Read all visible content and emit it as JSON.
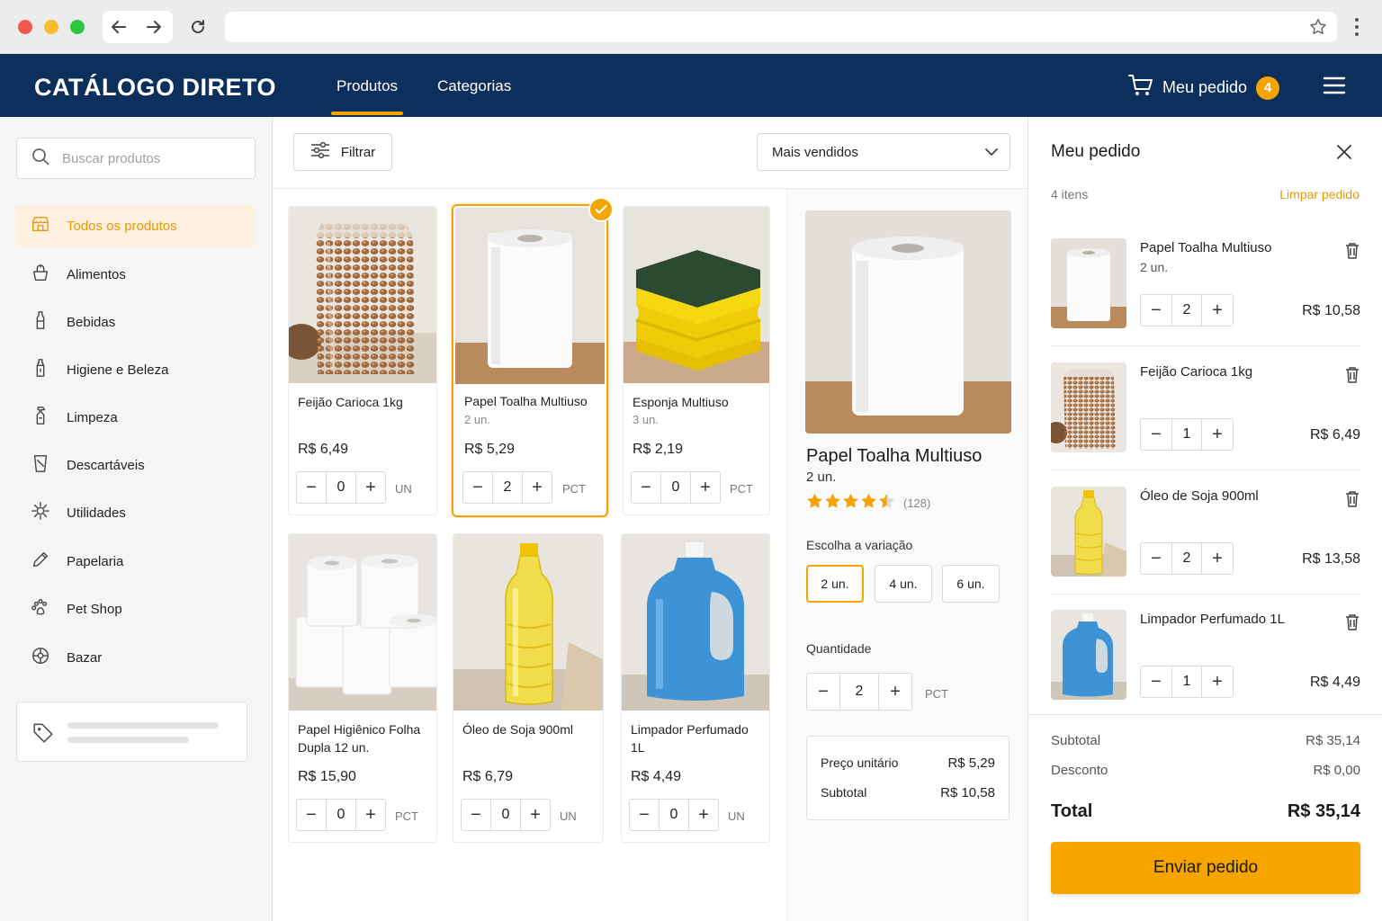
{
  "colors": {
    "brand_navy": "#0d2f5c",
    "accent": "#f5a400",
    "accent_text": "#e59a0c"
  },
  "header": {
    "brand": "CATÁLOGO DIRETO",
    "nav": [
      {
        "label": "Produtos",
        "active": true
      },
      {
        "label": "Categorias",
        "active": false
      }
    ],
    "cart_label": "Meu pedido",
    "cart_count": "4"
  },
  "sidebar": {
    "search_placeholder": "Buscar produtos",
    "categories": [
      {
        "label": "Todos os produtos",
        "icon": "store-icon",
        "active": true
      },
      {
        "label": "Alimentos",
        "icon": "food-icon"
      },
      {
        "label": "Bebidas",
        "icon": "bottle-icon"
      },
      {
        "label": "Higiene e Beleza",
        "icon": "hygiene-icon"
      },
      {
        "label": "Limpeza",
        "icon": "spray-bottle-icon"
      },
      {
        "label": "Descartáveis",
        "icon": "disposable-cup-icon"
      },
      {
        "label": "Utilidades",
        "icon": "utilities-icon"
      },
      {
        "label": "Papelaria",
        "icon": "pencil-icon"
      },
      {
        "label": "Pet Shop",
        "icon": "paw-icon"
      },
      {
        "label": "Bazar",
        "icon": "bazaar-icon"
      }
    ]
  },
  "toolbar": {
    "filter_label": "Filtrar",
    "sort_value": "Mais vendidos"
  },
  "products": [
    {
      "name": "Feijão Carioca 1kg",
      "variant": "",
      "price": "R$ 6,49",
      "qty": "0",
      "unit": "UN",
      "image": "beans"
    },
    {
      "name": "Papel Toalha Multiuso",
      "variant": "2 un.",
      "price": "R$ 5,29",
      "qty": "2",
      "unit": "PCT",
      "image": "towel",
      "selected": true
    },
    {
      "name": "Esponja Multiuso",
      "variant": "3 un.",
      "price": "R$ 2,19",
      "qty": "0",
      "unit": "PCT",
      "image": "sponge"
    },
    {
      "name": "Papel Higiênico Folha Dupla 12 un.",
      "variant": "",
      "price": "R$ 15,90",
      "qty": "0",
      "unit": "PCT",
      "image": "tp"
    },
    {
      "name": "Óleo de Soja 900ml",
      "variant": "",
      "price": "R$ 6,79",
      "qty": "0",
      "unit": "UN",
      "image": "oil"
    },
    {
      "name": "Limpador Perfumado 1L",
      "variant": "",
      "price": "R$ 4,49",
      "qty": "0",
      "unit": "UN",
      "image": "cleaner"
    }
  ],
  "detail": {
    "name": "Papel Toalha Multiuso",
    "variant": "2 un.",
    "rating": 4.5,
    "review_count": "(128)",
    "variation_label": "Escolha a variação",
    "options": [
      {
        "label": "2 un.",
        "active": true
      },
      {
        "label": "4 un."
      },
      {
        "label": "6 un."
      }
    ],
    "quantity_label": "Quantidade",
    "qty": "2",
    "unit": "PCT",
    "unit_price_label": "Preço unitário",
    "unit_price": "R$ 5,29",
    "subtotal_label": "Subtotal",
    "subtotal": "R$ 10,58"
  },
  "order": {
    "title": "Meu pedido",
    "count_label": "4 itens",
    "clear_label": "Limpar pedido",
    "items": [
      {
        "name": "Papel Toalha Multiuso",
        "variant": "2 un.",
        "qty": "2",
        "price": "R$ 10,58",
        "image": "towel"
      },
      {
        "name": "Feijão Carioca 1kg",
        "variant": "",
        "qty": "1",
        "price": "R$ 6,49",
        "image": "beans"
      },
      {
        "name": "Óleo de Soja 900ml",
        "variant": "",
        "qty": "2",
        "price": "R$ 13,58",
        "image": "oil"
      },
      {
        "name": "Limpador Perfumado 1L",
        "variant": "",
        "qty": "1",
        "price": "R$ 4,49",
        "image": "cleaner"
      }
    ],
    "subtotal_label": "Subtotal",
    "subtotal": "R$ 35,14",
    "discount_label": "Desconto",
    "discount": "R$ 0,00",
    "total_label": "Total",
    "total": "R$ 35,14",
    "send_label": "Enviar pedido"
  }
}
